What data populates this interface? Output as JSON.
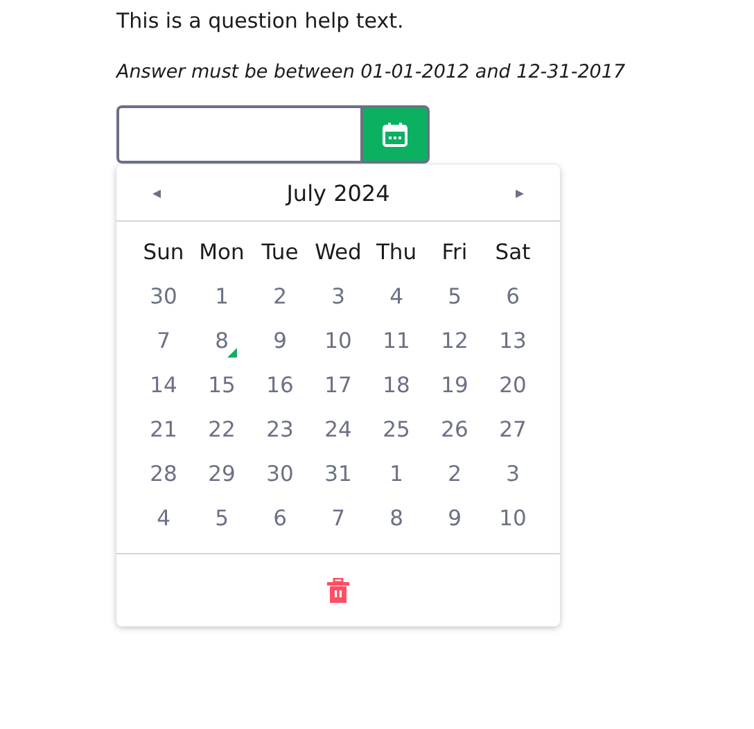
{
  "help_text": "This is a question help text.",
  "hint": "Answer must be between 01-01-2012 and 12-31-2017",
  "calendar": {
    "prev": "◂",
    "title": "July 2024",
    "next": "▸",
    "weekdays": [
      "Sun",
      "Mon",
      "Tue",
      "Wed",
      "Thu",
      "Fri",
      "Sat"
    ],
    "days": [
      {
        "label": "30",
        "today": false
      },
      {
        "label": "1",
        "today": false
      },
      {
        "label": "2",
        "today": false
      },
      {
        "label": "3",
        "today": false
      },
      {
        "label": "4",
        "today": false
      },
      {
        "label": "5",
        "today": false
      },
      {
        "label": "6",
        "today": false
      },
      {
        "label": "7",
        "today": false
      },
      {
        "label": "8",
        "today": true
      },
      {
        "label": "9",
        "today": false
      },
      {
        "label": "10",
        "today": false
      },
      {
        "label": "11",
        "today": false
      },
      {
        "label": "12",
        "today": false
      },
      {
        "label": "13",
        "today": false
      },
      {
        "label": "14",
        "today": false
      },
      {
        "label": "15",
        "today": false
      },
      {
        "label": "16",
        "today": false
      },
      {
        "label": "17",
        "today": false
      },
      {
        "label": "18",
        "today": false
      },
      {
        "label": "19",
        "today": false
      },
      {
        "label": "20",
        "today": false
      },
      {
        "label": "21",
        "today": false
      },
      {
        "label": "22",
        "today": false
      },
      {
        "label": "23",
        "today": false
      },
      {
        "label": "24",
        "today": false
      },
      {
        "label": "25",
        "today": false
      },
      {
        "label": "26",
        "today": false
      },
      {
        "label": "27",
        "today": false
      },
      {
        "label": "28",
        "today": false
      },
      {
        "label": "29",
        "today": false
      },
      {
        "label": "30",
        "today": false
      },
      {
        "label": "31",
        "today": false
      },
      {
        "label": "1",
        "today": false
      },
      {
        "label": "2",
        "today": false
      },
      {
        "label": "3",
        "today": false
      },
      {
        "label": "4",
        "today": false
      },
      {
        "label": "5",
        "today": false
      },
      {
        "label": "6",
        "today": false
      },
      {
        "label": "7",
        "today": false
      },
      {
        "label": "8",
        "today": false
      },
      {
        "label": "9",
        "today": false
      },
      {
        "label": "10",
        "today": false
      }
    ]
  }
}
